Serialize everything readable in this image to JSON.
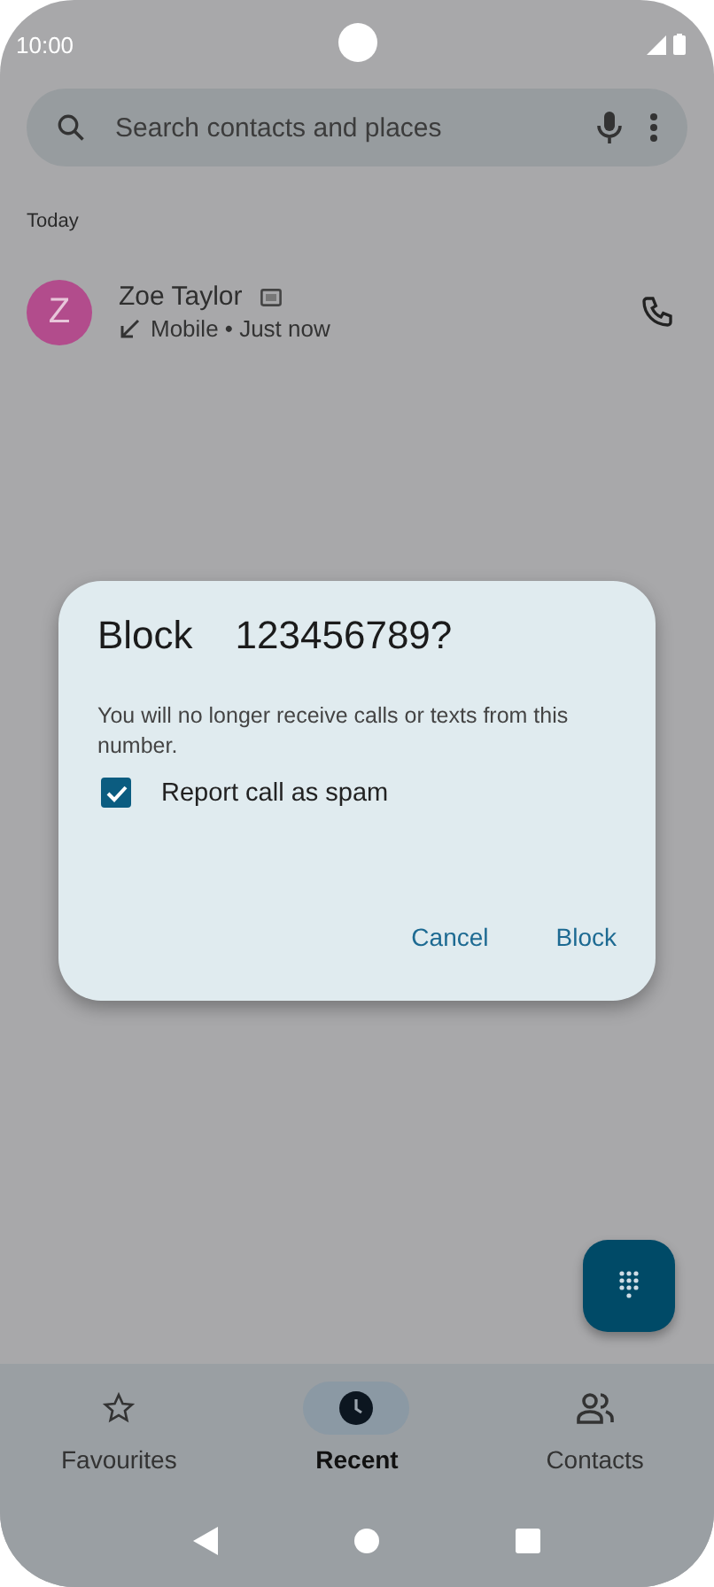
{
  "status_bar": {
    "time": "10:00"
  },
  "search": {
    "placeholder": "Search contacts and places"
  },
  "recents": {
    "section": "Today",
    "calls": [
      {
        "initial": "Z",
        "name": "Zoe Taylor",
        "color": "#b24c8c",
        "detail": "Mobile • Just now"
      }
    ]
  },
  "dialog": {
    "title": "Block",
    "number": "123456789?",
    "message": "You will no longer receive calls or texts from this number.",
    "checkbox": {
      "label": "Report call as spam",
      "checked": true
    },
    "buttons": [
      "Cancel",
      "Block"
    ]
  },
  "tabs": [
    {
      "label": "Favourites",
      "kind": "star",
      "selected": false
    },
    {
      "label": "Recent",
      "kind": "clock",
      "selected": true
    },
    {
      "label": "Contacts",
      "kind": "people",
      "selected": false
    }
  ]
}
